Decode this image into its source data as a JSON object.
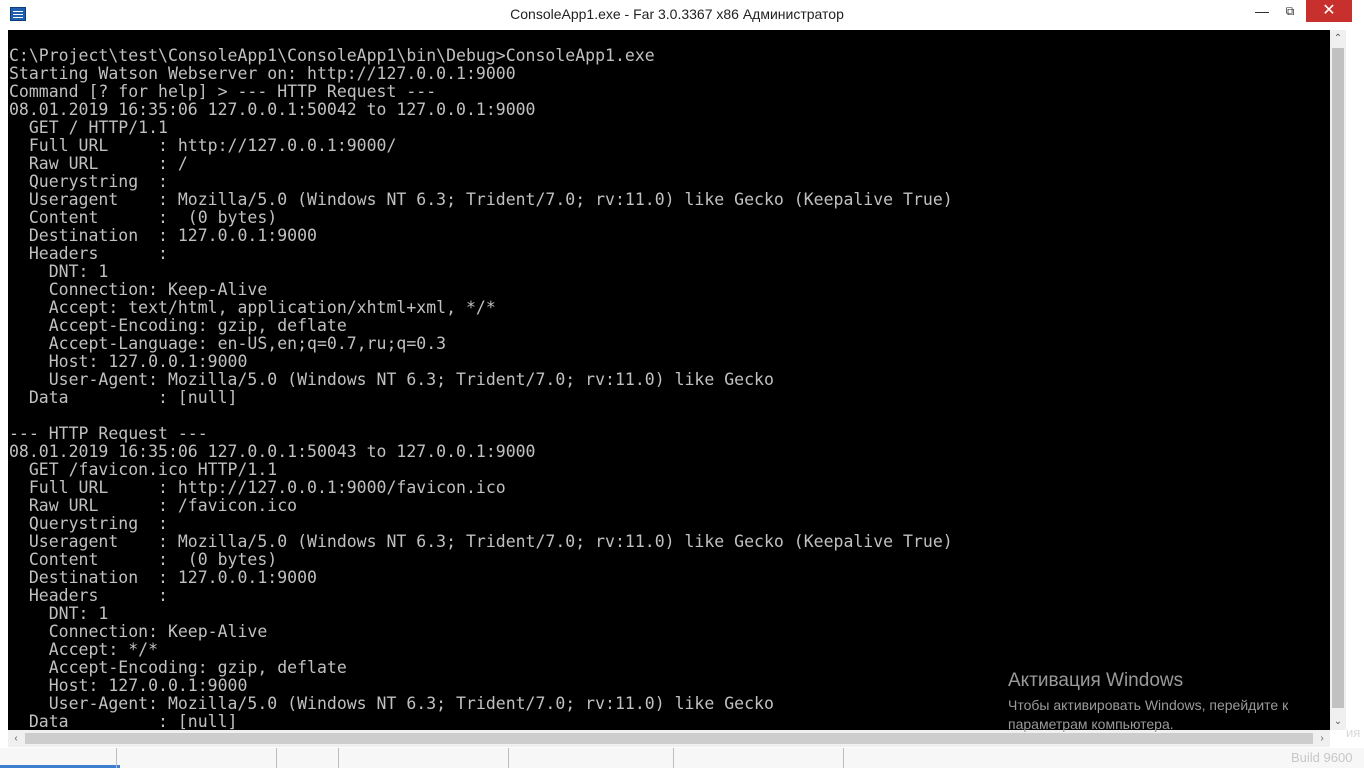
{
  "window": {
    "title": "ConsoleApp1.exe - Far 3.0.3367 x86 Администратор",
    "controls": {
      "minimize": "—",
      "maximize": "⧉",
      "close": "✕"
    }
  },
  "console": {
    "lines": [
      "C:\\Project\\test\\ConsoleApp1\\ConsoleApp1\\bin\\Debug>ConsoleApp1.exe",
      "Starting Watson Webserver on: http://127.0.0.1:9000",
      "Command [? for help] > --- HTTP Request ---",
      "08.01.2019 16:35:06 127.0.0.1:50042 to 127.0.0.1:9000",
      "  GET / HTTP/1.1",
      "  Full URL     : http://127.0.0.1:9000/",
      "  Raw URL      : /",
      "  Querystring  :",
      "  Useragent    : Mozilla/5.0 (Windows NT 6.3; Trident/7.0; rv:11.0) like Gecko (Keepalive True)",
      "  Content      :  (0 bytes)",
      "  Destination  : 127.0.0.1:9000",
      "  Headers      :",
      "    DNT: 1",
      "    Connection: Keep-Alive",
      "    Accept: text/html, application/xhtml+xml, */*",
      "    Accept-Encoding: gzip, deflate",
      "    Accept-Language: en-US,en;q=0.7,ru;q=0.3",
      "    Host: 127.0.0.1:9000",
      "    User-Agent: Mozilla/5.0 (Windows NT 6.3; Trident/7.0; rv:11.0) like Gecko",
      "  Data         : [null]",
      "",
      "--- HTTP Request ---",
      "08.01.2019 16:35:06 127.0.0.1:50043 to 127.0.0.1:9000",
      "  GET /favicon.ico HTTP/1.1",
      "  Full URL     : http://127.0.0.1:9000/favicon.ico",
      "  Raw URL      : /favicon.ico",
      "  Querystring  :",
      "  Useragent    : Mozilla/5.0 (Windows NT 6.3; Trident/7.0; rv:11.0) like Gecko (Keepalive True)",
      "  Content      :  (0 bytes)",
      "  Destination  : 127.0.0.1:9000",
      "  Headers      :",
      "    DNT: 1",
      "    Connection: Keep-Alive",
      "    Accept: */*",
      "    Accept-Encoding: gzip, deflate",
      "    Host: 127.0.0.1:9000",
      "    User-Agent: Mozilla/5.0 (Windows NT 6.3; Trident/7.0; rv:11.0) like Gecko",
      "  Data         : [null]"
    ]
  },
  "scrollbars": {
    "up_arrow": "⌃",
    "down_arrow": "⌄",
    "left_arrow": "‹",
    "right_arrow": "›"
  },
  "watermark": {
    "title": "Активация Windows",
    "text": "Чтобы активировать Windows, перейдите к параметрам компьютера."
  },
  "background": {
    "side_text": "ия",
    "build_label": "Build 9600"
  },
  "colors": {
    "console_bg": "#000000",
    "console_fg": "#c0c0c0",
    "close_button": "#c7302d"
  }
}
